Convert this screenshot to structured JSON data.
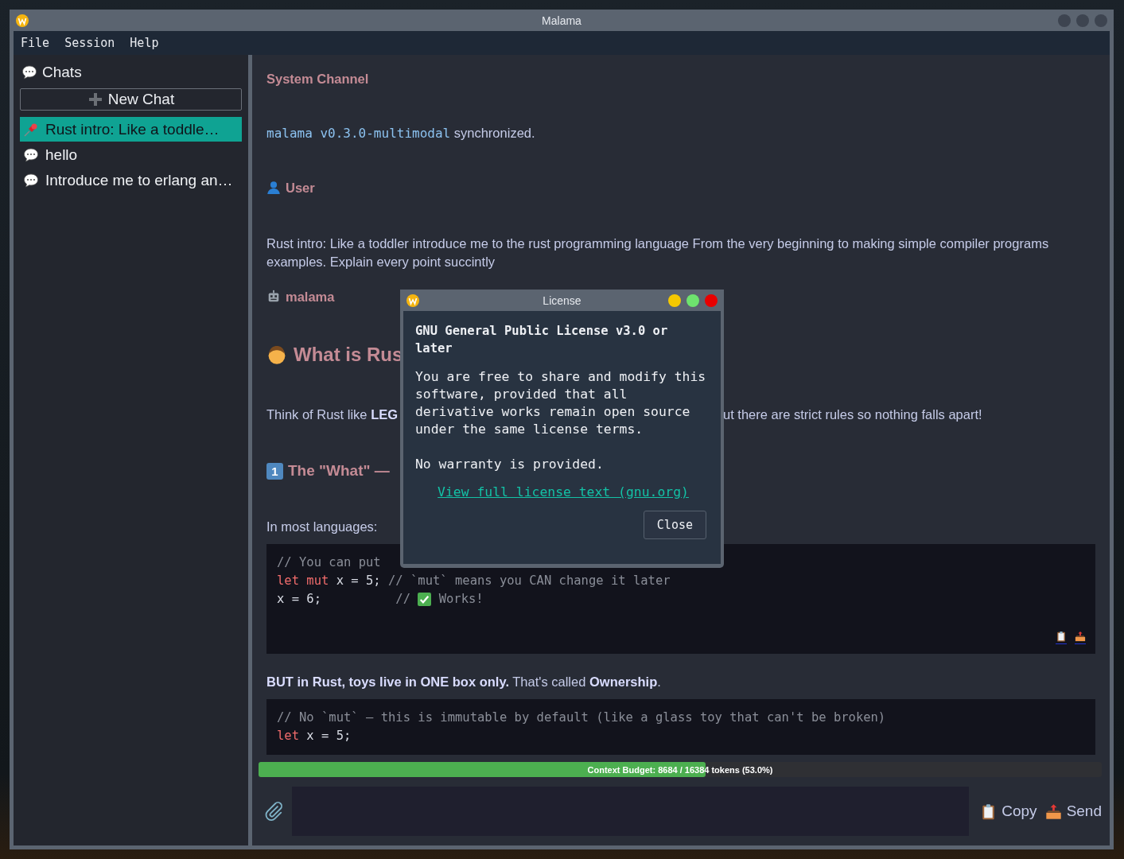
{
  "window": {
    "title": "Malama"
  },
  "menu": [
    "File",
    "Session",
    "Help"
  ],
  "sidebar": {
    "title": "Chats",
    "new_chat": "New Chat",
    "chats": [
      {
        "title": "Rust intro: Like a toddle…",
        "pinned": true,
        "selected": true
      },
      {
        "title": "hello",
        "pinned": false,
        "selected": false
      },
      {
        "title": "Introduce me to erlang an…",
        "pinned": false,
        "selected": false
      }
    ]
  },
  "messages": [
    {
      "kind": "sender",
      "label": "System Channel"
    },
    {
      "kind": "status",
      "code": "malama v0.3.0-multimodal",
      "text": "synchronized."
    },
    {
      "kind": "user_sender",
      "label": "User"
    },
    {
      "kind": "paragraph",
      "text": "Rust intro: Like a toddler introduce me to the rust programming language From the very beginning to making simple compiler programs examples. Explain every point succintly"
    },
    {
      "kind": "bot_sender",
      "label": "malama"
    },
    {
      "kind": "heading",
      "text": "What is Rus"
    },
    {
      "kind": "split",
      "left": "Think of Rust like **LEG**",
      "right": "ut there are strict rules so nothing falls apart!"
    },
    {
      "kind": "subheading",
      "keycap": "1",
      "text": "The \"What\" —"
    },
    {
      "kind": "paragraph",
      "text": "In most languages:"
    },
    {
      "kind": "code",
      "actions": true,
      "lines": [
        [
          {
            "kind": "comment",
            "s": "// You can put"
          }
        ],
        [
          {
            "kind": "keyword",
            "s": "let mut"
          },
          {
            "kind": "plain",
            "s": " x = 5; "
          },
          {
            "kind": "comment",
            "s": "// `mut` means you CAN change it later"
          }
        ],
        [
          {
            "kind": "plain",
            "s": "x = 6;          "
          },
          {
            "kind": "comment",
            "s": "// "
          },
          {
            "kind": "check"
          },
          {
            "kind": "comment",
            "s": " Works!"
          }
        ]
      ]
    },
    {
      "kind": "paragraph",
      "text": "**BUT in Rust, toys live in ONE box only.** That's called **Ownership**."
    },
    {
      "kind": "code",
      "actions": false,
      "lines": [
        [
          {
            "kind": "comment",
            "s": "// No `mut` — this is immutable by default (like a glass toy that can't be broken)"
          }
        ],
        [
          {
            "kind": "keyword",
            "s": "let"
          },
          {
            "kind": "plain",
            "s": " x = 5;"
          }
        ]
      ]
    }
  ],
  "budget": {
    "label": "Context Budget: 8684 / 16384 tokens (53.0%)",
    "level": 0.53
  },
  "composer": {
    "copy": "Copy",
    "send": "Send"
  },
  "dialog": {
    "title": "License",
    "heading": "GNU General Public License v3.0 or later",
    "body": "You are free to share and modify this software, provided that all derivative works remain open source under the same license terms.",
    "note": "No warranty is provided.",
    "link": "View full license text (gnu.org)",
    "button": "Close"
  }
}
